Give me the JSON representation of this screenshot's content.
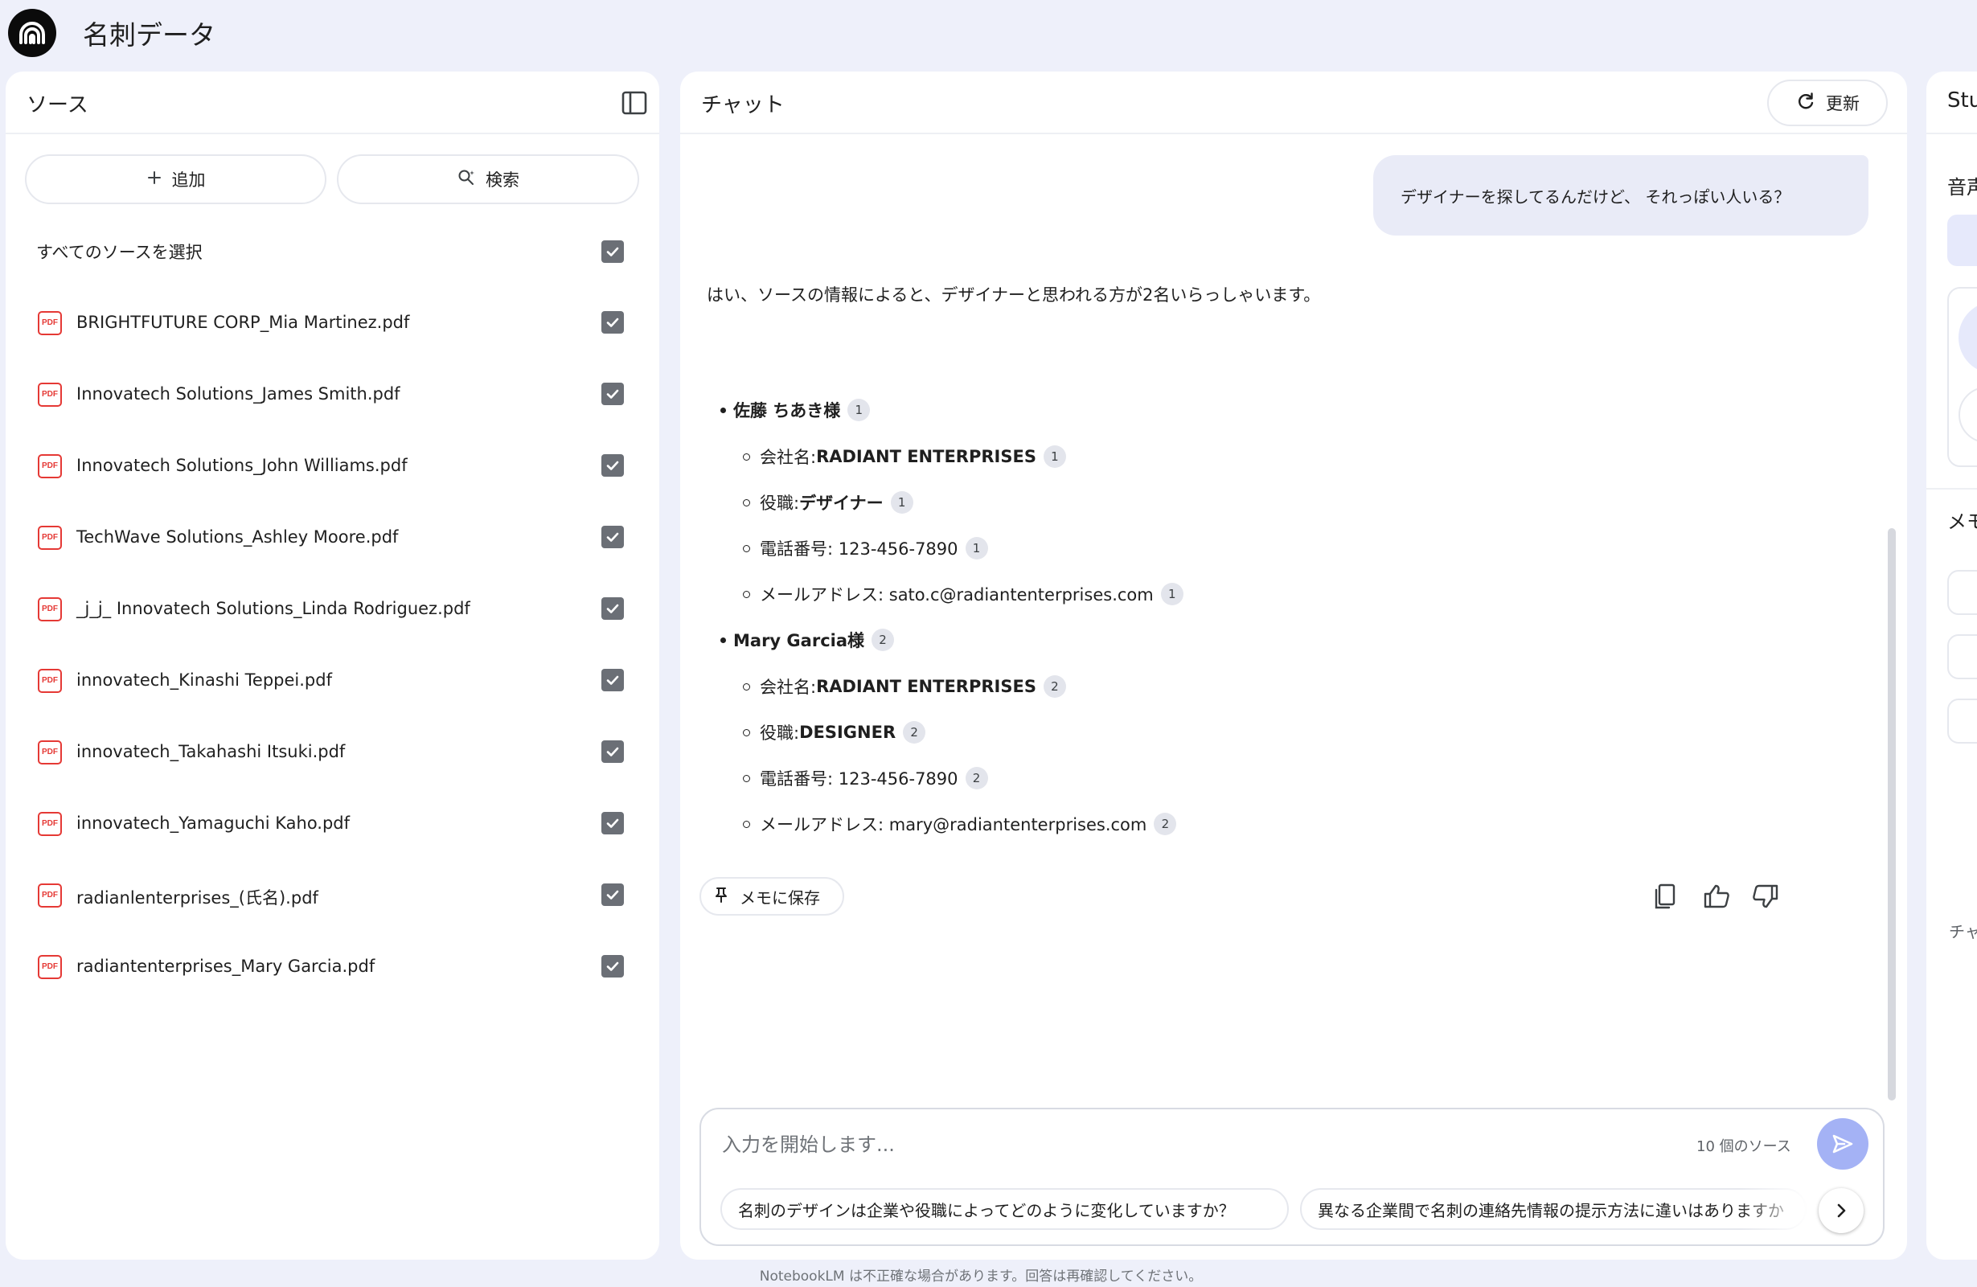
{
  "app": {
    "title": "名刺データ"
  },
  "sources": {
    "title": "ソース",
    "add_label": "追加",
    "search_label": "検索",
    "select_all_label": "すべてのソースを選択",
    "items": [
      {
        "name": "BRIGHTFUTURE CORP_Mia Martinez.pdf",
        "checked": true
      },
      {
        "name": "Innovatech Solutions_James Smith.pdf",
        "checked": true
      },
      {
        "name": "Innovatech Solutions_John Williams.pdf",
        "checked": true
      },
      {
        "name": "TechWave Solutions_Ashley Moore.pdf",
        "checked": true
      },
      {
        "name": "_j_j_ Innovatech Solutions_Linda Rodriguez.pdf",
        "checked": true
      },
      {
        "name": "innovatech_Kinashi Teppei.pdf",
        "checked": true
      },
      {
        "name": "innovatech_Takahashi Itsuki.pdf",
        "checked": true
      },
      {
        "name": "innovatech_Yamaguchi Kaho.pdf",
        "checked": true
      },
      {
        "name": "radianlenterprises_(氏名).pdf",
        "checked": true
      },
      {
        "name": "radiantenterprises_Mary Garcia.pdf",
        "checked": true
      }
    ],
    "pdf_icon_text": "PDF"
  },
  "chat": {
    "title": "チャット",
    "refresh_label": "更新",
    "user_message": "デザイナーを探してるんだけど、 それっぽい人いる？",
    "answer": {
      "intro": "はい、ソースの情報によると、デザイナーと思われる方が2名いらっしゃいます。",
      "people": [
        {
          "name": "佐藤 ちあき様",
          "citation": "1",
          "company_label": "会社名: ",
          "company": "RADIANT ENTERPRISES",
          "company_cite": "1",
          "role_label": "役職: ",
          "role": "デザイナー",
          "role_cite": "1",
          "phone": "電話番号: 123-456-7890",
          "phone_cite": "1",
          "email": "メールアドレス: sato.c@radiantenterprises.com",
          "email_cite": "1"
        },
        {
          "name": "Mary Garcia様",
          "citation": "2",
          "company_label": "会社名: ",
          "company": "RADIANT ENTERPRISES",
          "company_cite": "2",
          "role_label": "役職: ",
          "role": "DESIGNER",
          "role_cite": "2",
          "phone": "電話番号: 123-456-7890",
          "phone_cite": "2",
          "email": "メールアドレス: mary@radiantenterprises.com",
          "email_cite": "2"
        }
      ]
    },
    "save_note_label": "メモに保存",
    "input_placeholder": "入力を開始します...",
    "source_count": "10 個のソース",
    "suggestions": [
      "名刺のデザインは企業や役職によってどのように変化していますか？",
      "異なる企業間で名刺の連絡先情報の提示方法に違いはありますか"
    ],
    "disclaimer": "NotebookLM は不正確な場合があります。回答は再確認してください。"
  },
  "studio": {
    "title": "Studio",
    "audio_label": "音声",
    "memo_label": "メモ",
    "hint": "チャ"
  },
  "colors": {
    "background": "#eef0fa",
    "panel": "#ffffff",
    "accent": "#a4b2f5",
    "user_bubble": "#e9ebf7",
    "pdf_red": "#e53935",
    "checkbox": "#6b6f76"
  }
}
